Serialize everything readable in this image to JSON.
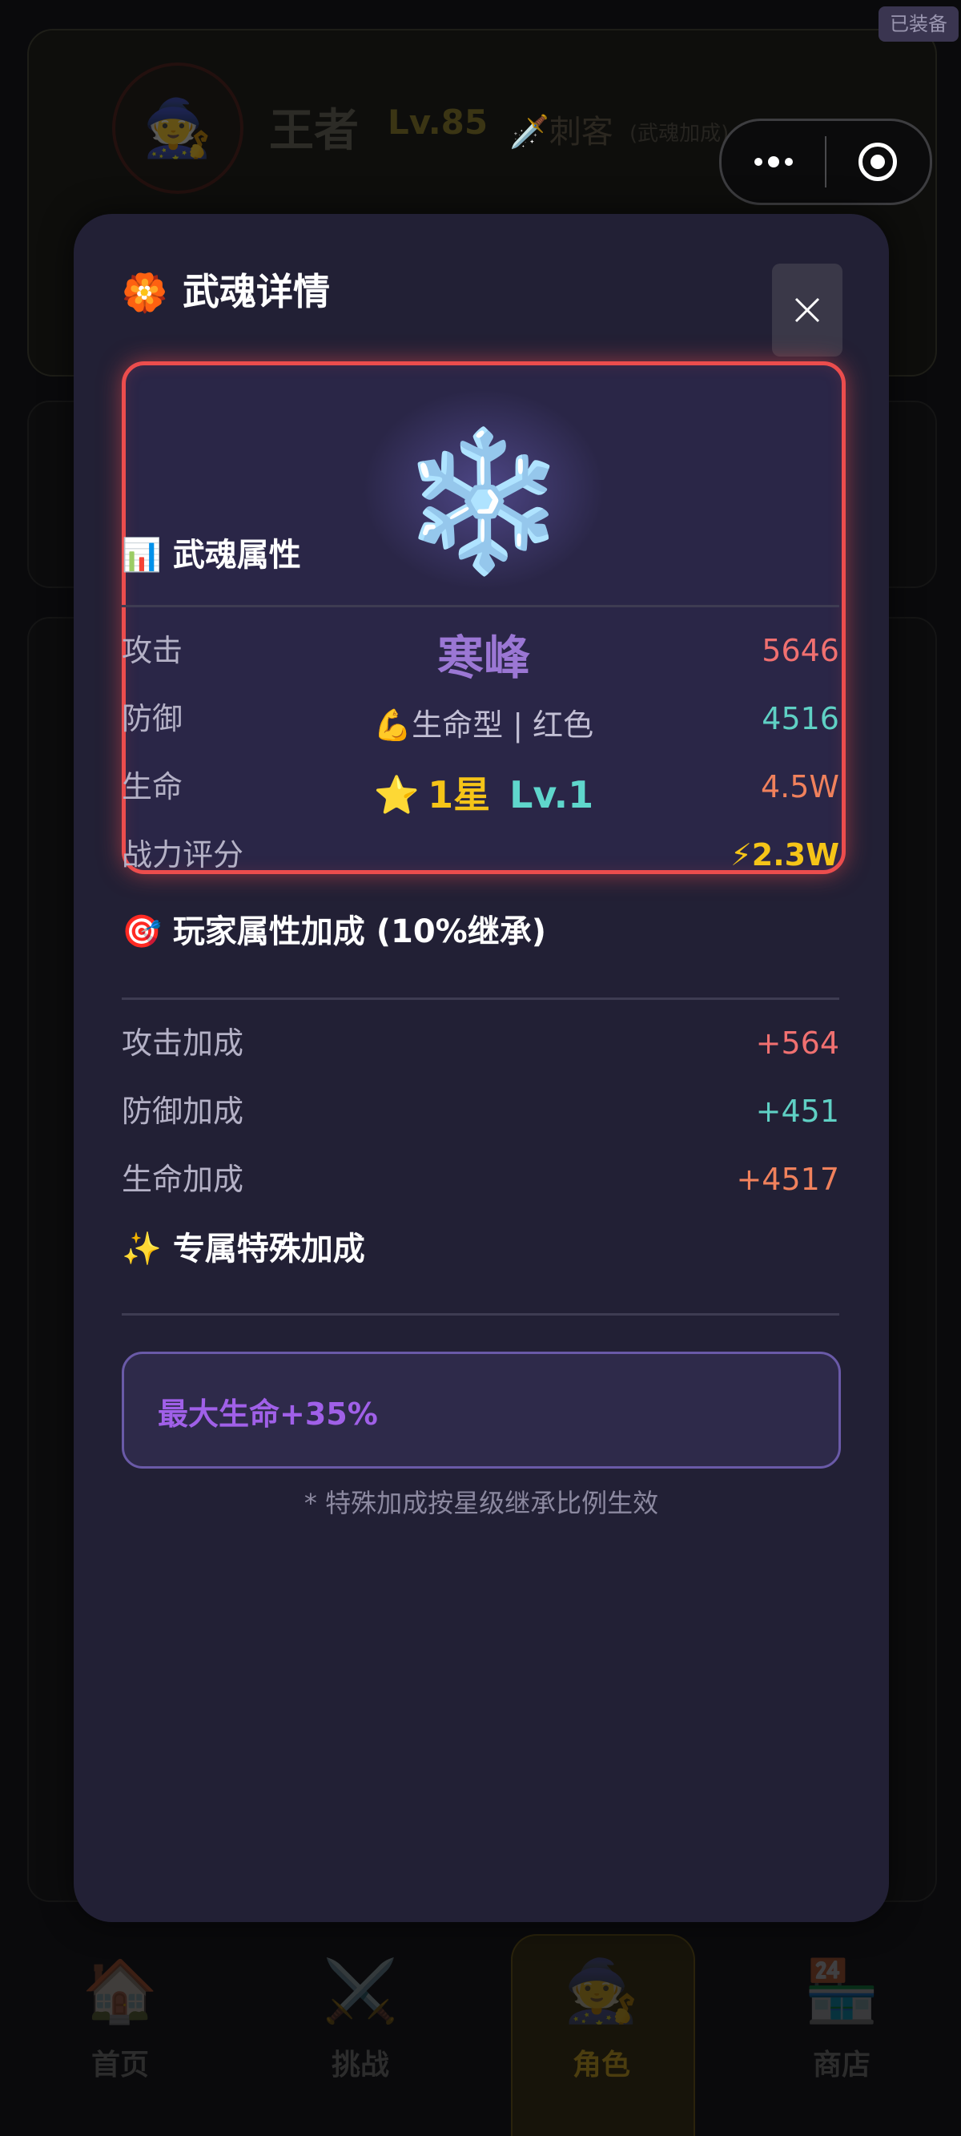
{
  "background": {
    "equipped_badge": "已装备",
    "player": {
      "name": "王者",
      "level": "Lv.85",
      "class": "刺客",
      "class_sub": "(武魂加成)"
    },
    "nav": [
      {
        "label": "首页",
        "icon": "home-icon"
      },
      {
        "label": "挑战",
        "icon": "crossed-swords-icon"
      },
      {
        "label": "角色",
        "icon": "character-icon",
        "active": true
      },
      {
        "label": "商店",
        "icon": "store-icon"
      }
    ]
  },
  "capsule": {
    "more_icon": "more-dots-icon",
    "close_icon": "target-icon"
  },
  "modal": {
    "title_icon": "flower-icon",
    "title": "武魂详情",
    "close_icon": "close-icon",
    "hero": {
      "icon": "snowflake-icon",
      "name": "寒峰",
      "type": "💪生命型 | 红色",
      "star_icon": "⭐",
      "stars": "1星",
      "level": "Lv.1",
      "accent_color": "#ec4d4d"
    },
    "attributes": {
      "icon": "📊",
      "title": "武魂属性",
      "rows": [
        {
          "label": "攻击",
          "value": "5646",
          "color": "#f07070"
        },
        {
          "label": "防御",
          "value": "4516",
          "color": "#5fd0c4"
        },
        {
          "label": "生命",
          "value": "4.5W",
          "color": "#f0815c"
        },
        {
          "label": "战力评分",
          "value": "⚡2.3W",
          "color": "#f5c418"
        }
      ]
    },
    "bonus": {
      "icon": "🎯",
      "title": "玩家属性加成 (10%继承)",
      "rows": [
        {
          "label": "攻击加成",
          "value": "+564",
          "color": "#f07070"
        },
        {
          "label": "防御加成",
          "value": "+451",
          "color": "#5fd0c4"
        },
        {
          "label": "生命加成",
          "value": "+4517",
          "color": "#f0815c"
        }
      ]
    },
    "special": {
      "icon": "✨",
      "title": "专属特殊加成",
      "effect": "最大生命+35%",
      "footnote": "* 特殊加成按星级继承比例生效"
    }
  }
}
